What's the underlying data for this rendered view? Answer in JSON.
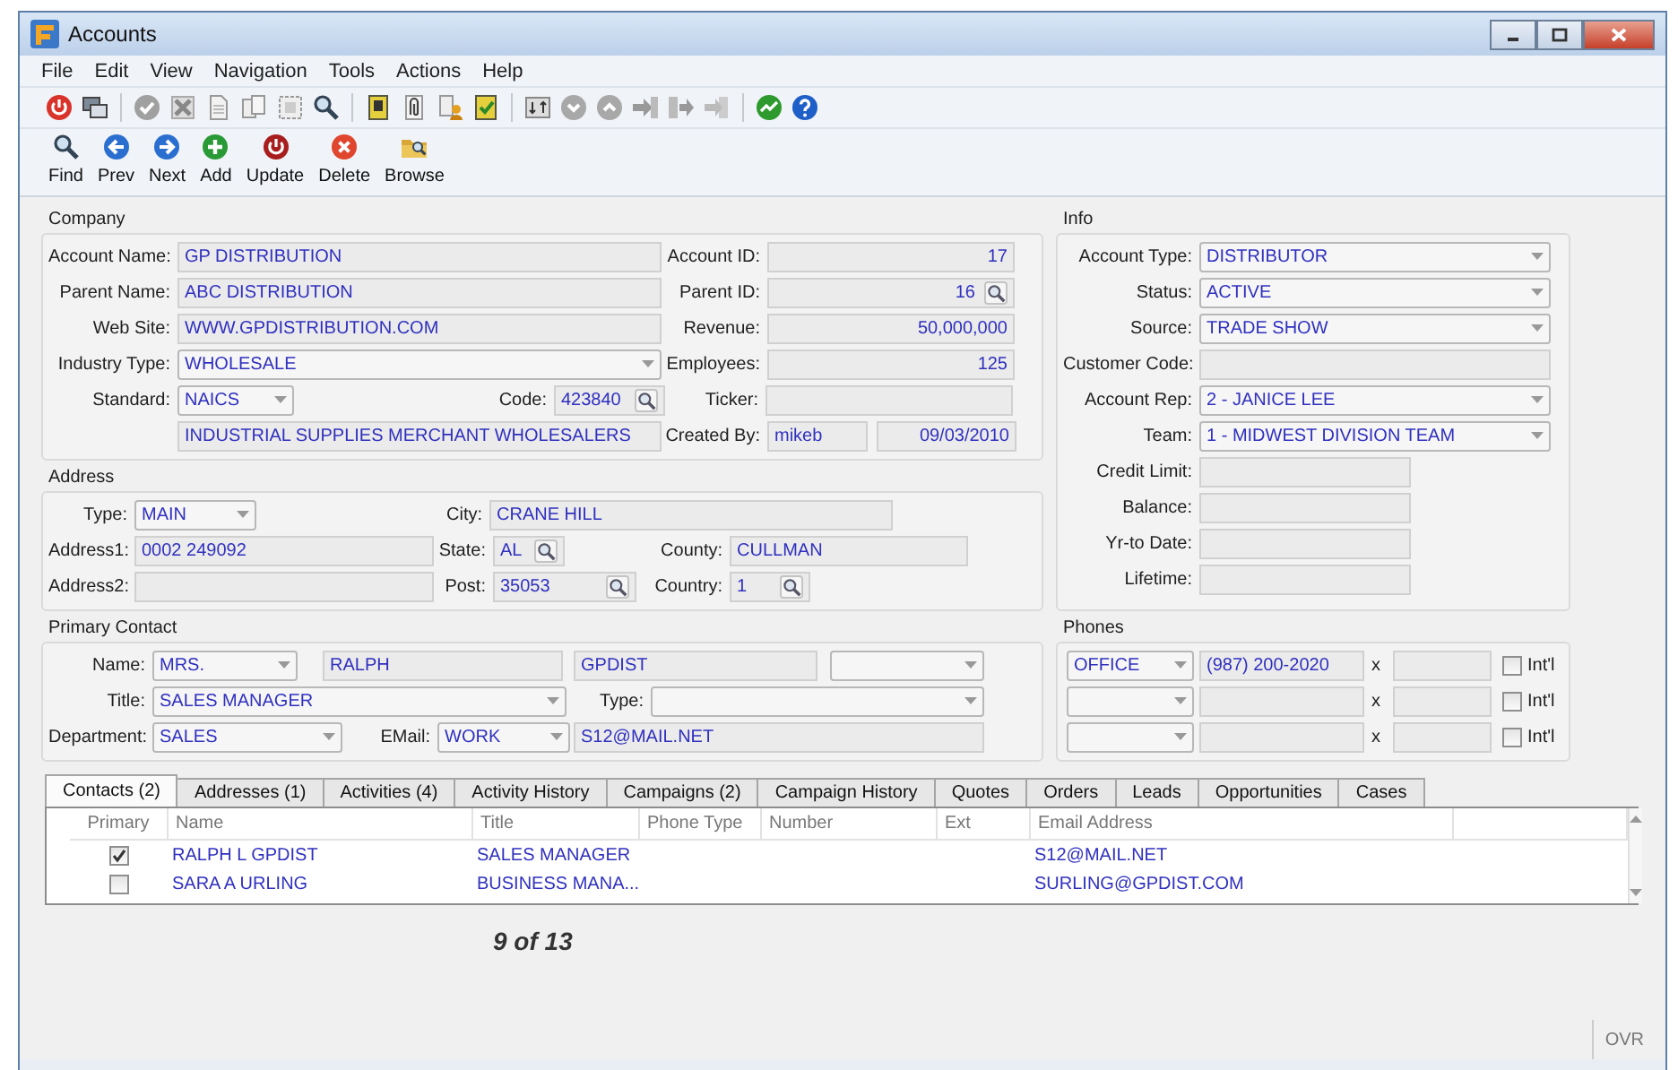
{
  "window": {
    "title": "Accounts"
  },
  "menu": [
    "File",
    "Edit",
    "View",
    "Navigation",
    "Tools",
    "Actions",
    "Help"
  ],
  "nav_buttons": [
    "Find",
    "Prev",
    "Next",
    "Add",
    "Update",
    "Delete",
    "Browse"
  ],
  "company": {
    "title": "Company",
    "fields": [
      {
        "label": "Account Name:",
        "value": "GP DISTRIBUTION",
        "kind": "text"
      },
      {
        "label": "Account ID:",
        "value": "17",
        "kind": "number"
      },
      {
        "label": "Parent Name:",
        "value": "ABC DISTRIBUTION",
        "kind": "text"
      },
      {
        "label": "Parent ID:",
        "value": "16",
        "kind": "number_lookup"
      },
      {
        "label": "Web Site:",
        "value": "WWW.GPDISTRIBUTION.COM",
        "kind": "text"
      },
      {
        "label": "Revenue:",
        "value": "50,000,000",
        "kind": "number"
      },
      {
        "label": "Industry Type:",
        "value": "WHOLESALE",
        "kind": "combo"
      },
      {
        "label": "Employees:",
        "value": "125",
        "kind": "number"
      },
      {
        "label": "Standard:",
        "value": "NAICS",
        "kind": "combo"
      },
      {
        "label": "Code:",
        "value": "423840",
        "kind": "lookup"
      },
      {
        "label": "Ticker:",
        "kind": "text"
      },
      {
        "value": "INDUSTRIAL SUPPLIES MERCHANT WHOLESALERS",
        "kind": "text"
      },
      {
        "label": "Created By:",
        "value": "mikeb",
        "kind": "text"
      },
      {
        "value": "09/03/2010",
        "kind": "number"
      }
    ]
  },
  "address": {
    "title": "Address",
    "fields": [
      {
        "label": "Type:",
        "value": "MAIN",
        "kind": "combo"
      },
      {
        "label": "City:",
        "value": "CRANE HILL",
        "kind": "text"
      },
      {
        "label": "Address1:",
        "value": "0002 249092",
        "kind": "text"
      },
      {
        "label": "State:",
        "value": "AL",
        "kind": "lookup"
      },
      {
        "label": "County:",
        "value": "CULLMAN",
        "kind": "text"
      },
      {
        "label": "Address2:",
        "kind": "text"
      },
      {
        "label": "Post:",
        "value": "35053",
        "kind": "lookup"
      },
      {
        "label": "Country:",
        "value": "1",
        "kind": "lookup"
      }
    ]
  },
  "primary_contact": {
    "title": "Primary Contact",
    "fields": [
      {
        "label": "Name:",
        "value": "MRS.",
        "kind": "combo"
      },
      {
        "value": "RALPH",
        "kind": "text"
      },
      {
        "value": "GPDIST",
        "kind": "text"
      },
      {
        "kind": "combo"
      },
      {
        "label": "Title:",
        "value": "SALES MANAGER",
        "kind": "combo"
      },
      {
        "label": "Type:",
        "kind": "combo"
      },
      {
        "label": "Department:",
        "value": "SALES",
        "kind": "combo"
      },
      {
        "label": "EMail:",
        "value": "WORK",
        "kind": "combo"
      },
      {
        "value": "S12@MAIL.NET",
        "kind": "text"
      }
    ]
  },
  "info": {
    "title": "Info",
    "fields": [
      {
        "label": "Account Type:",
        "value": "DISTRIBUTOR",
        "kind": "combo"
      },
      {
        "label": "Status:",
        "value": "ACTIVE",
        "kind": "combo"
      },
      {
        "label": "Source:",
        "value": "TRADE SHOW",
        "kind": "combo"
      },
      {
        "label": "Customer Code:",
        "kind": "text"
      },
      {
        "label": "Account Rep:",
        "value": "2 - JANICE LEE",
        "kind": "combo"
      },
      {
        "label": "Team:",
        "value": "1 - MIDWEST DIVISION TEAM",
        "kind": "combo"
      },
      {
        "label": "Credit Limit:",
        "kind": "text"
      },
      {
        "label": "Balance:",
        "kind": "text"
      },
      {
        "label": "Yr-to Date:",
        "kind": "text"
      },
      {
        "label": "Lifetime:",
        "kind": "text"
      }
    ]
  },
  "phones": {
    "title": "Phones",
    "rows": [
      {
        "type": "OFFICE",
        "number": "(987) 200-2020",
        "ext_mark": "x",
        "intl_label": "Int'l",
        "intl_checked": false
      },
      {
        "ext_mark": "x",
        "intl_label": "Int'l",
        "intl_checked": false
      },
      {
        "ext_mark": "x",
        "intl_label": "Int'l",
        "intl_checked": false
      }
    ]
  },
  "tabs": [
    {
      "label": "Contacts (2)",
      "selected": true
    },
    {
      "label": "Addresses (1)",
      "selected": false
    },
    {
      "label": "Activities (4)",
      "selected": false
    },
    {
      "label": "Activity History",
      "selected": false
    },
    {
      "label": "Campaigns (2)",
      "selected": false
    },
    {
      "label": "Campaign History",
      "selected": false
    },
    {
      "label": "Quotes",
      "selected": false
    },
    {
      "label": "Orders",
      "selected": false
    },
    {
      "label": "Leads",
      "selected": false
    },
    {
      "label": "Opportunities",
      "selected": false
    },
    {
      "label": "Cases",
      "selected": false
    }
  ],
  "contacts_grid": {
    "columns": [
      "Primary",
      "Name",
      "Title",
      "Phone Type",
      "Number",
      "Ext",
      "Email Address"
    ],
    "rows": [
      {
        "primary": true,
        "name": "RALPH L GPDIST",
        "title": "SALES MANAGER",
        "email": "S12@MAIL.NET"
      },
      {
        "primary": false,
        "name": "SARA A URLING",
        "title": "BUSINESS MANA...",
        "email": "SURLING@GPDIST.COM"
      }
    ]
  },
  "record_position": "9 of 13",
  "status_bar": {
    "mode": "OVR"
  }
}
